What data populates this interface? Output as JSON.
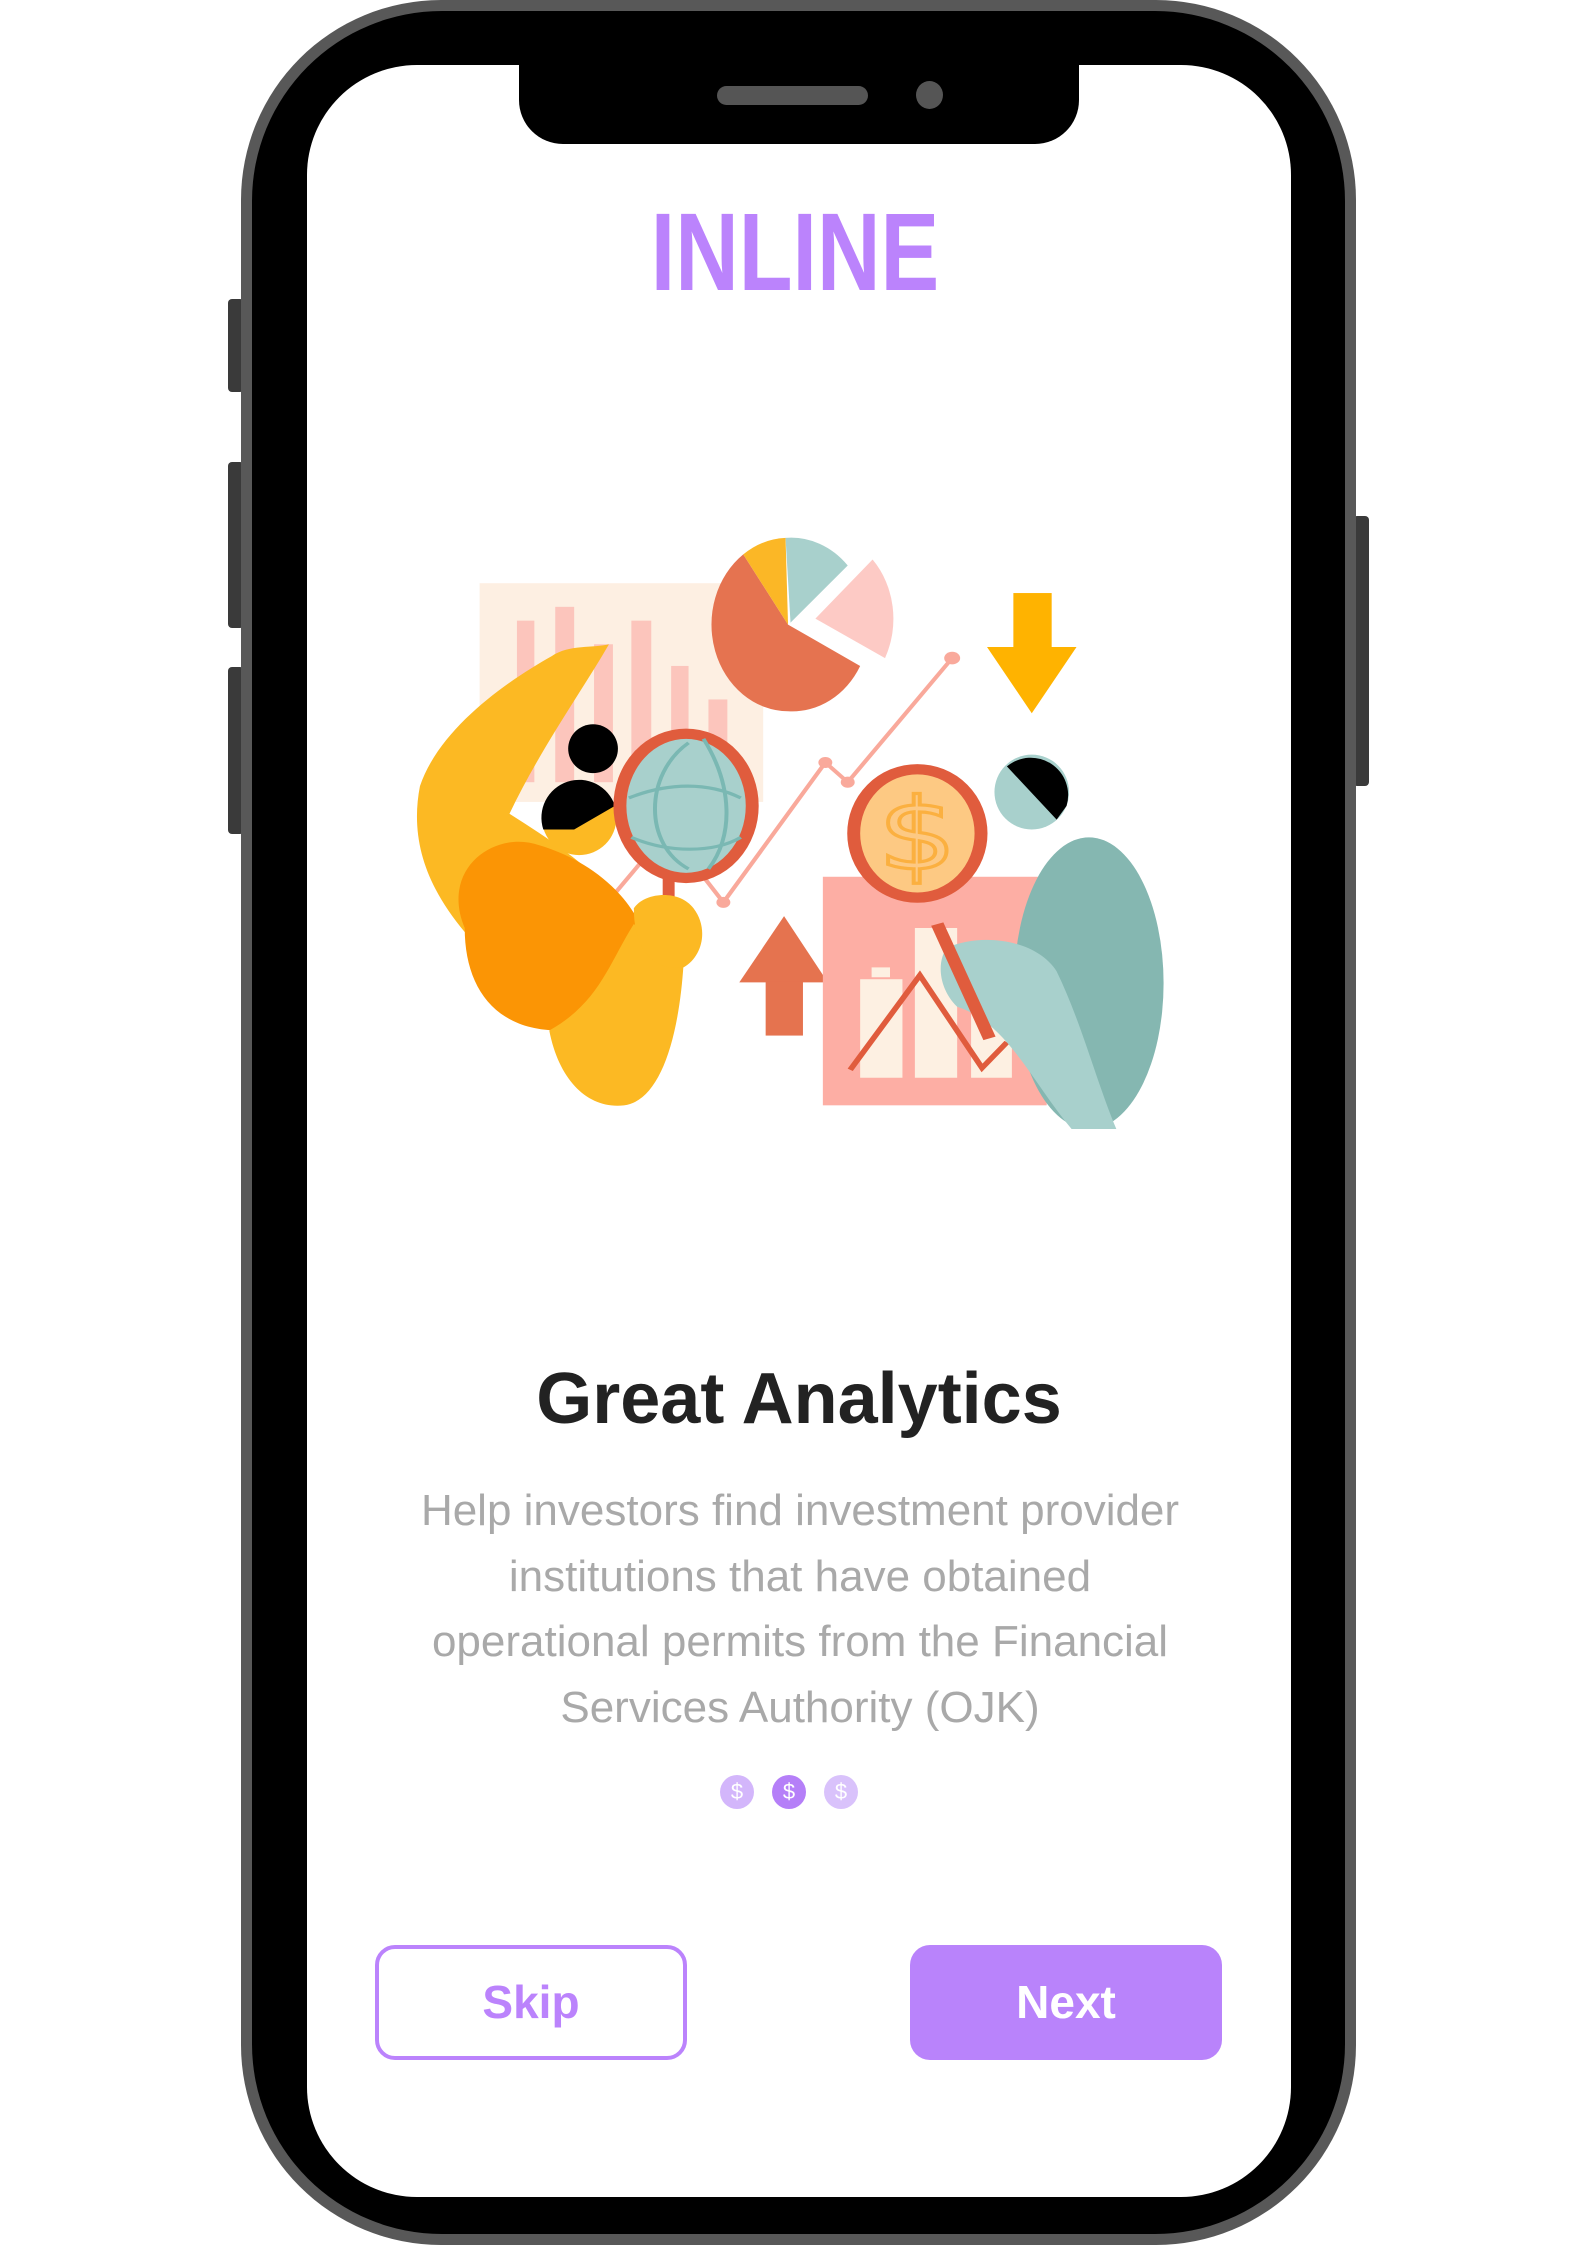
{
  "app": {
    "logo": "INLINE"
  },
  "onboarding": {
    "illustration": "analytics-illustration",
    "title": "Great Analytics",
    "description": "Help investors find investment provider institutions that have obtained operational permits from the Financial Services Authority (OJK)",
    "pager": {
      "dots": [
        {
          "glyph": "$",
          "color": "#d3b6fb"
        },
        {
          "glyph": "$",
          "color": "#b57ff8"
        },
        {
          "glyph": "$",
          "color": "#d9c2fb"
        }
      ],
      "active_index": 1
    }
  },
  "actions": {
    "skip_label": "Skip",
    "next_label": "Next"
  },
  "colors": {
    "accent": "#bb83fc",
    "title": "#222222",
    "body": "#a9a9a9"
  }
}
